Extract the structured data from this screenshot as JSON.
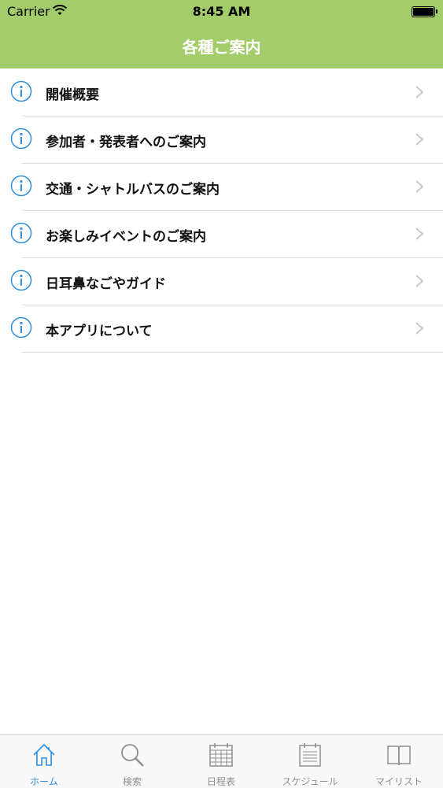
{
  "status_bar": {
    "carrier": "Carrier",
    "time": "8:45 AM"
  },
  "header": {
    "title": "各種ご案内"
  },
  "list": {
    "items": [
      {
        "label": "開催概要",
        "icon": "info-icon"
      },
      {
        "label": "参加者・発表者へのご案内",
        "icon": "info-icon"
      },
      {
        "label": "交通・シャトルバスのご案内",
        "icon": "info-icon"
      },
      {
        "label": "お楽しみイベントのご案内",
        "icon": "info-icon"
      },
      {
        "label": "日耳鼻なごやガイド",
        "icon": "info-icon"
      },
      {
        "label": "本アプリについて",
        "icon": "info-icon"
      }
    ]
  },
  "tab_bar": {
    "tabs": [
      {
        "label": "ホーム",
        "icon": "home-icon",
        "active": true
      },
      {
        "label": "検索",
        "icon": "search-icon",
        "active": false
      },
      {
        "label": "日程表",
        "icon": "calendar-icon",
        "active": false
      },
      {
        "label": "スケジュール",
        "icon": "schedule-icon",
        "active": false
      },
      {
        "label": "マイリスト",
        "icon": "book-icon",
        "active": false
      }
    ]
  },
  "colors": {
    "header_bg": "#a3cc6a",
    "accent": "#2f8fdc",
    "inactive": "#8e8e8e"
  }
}
